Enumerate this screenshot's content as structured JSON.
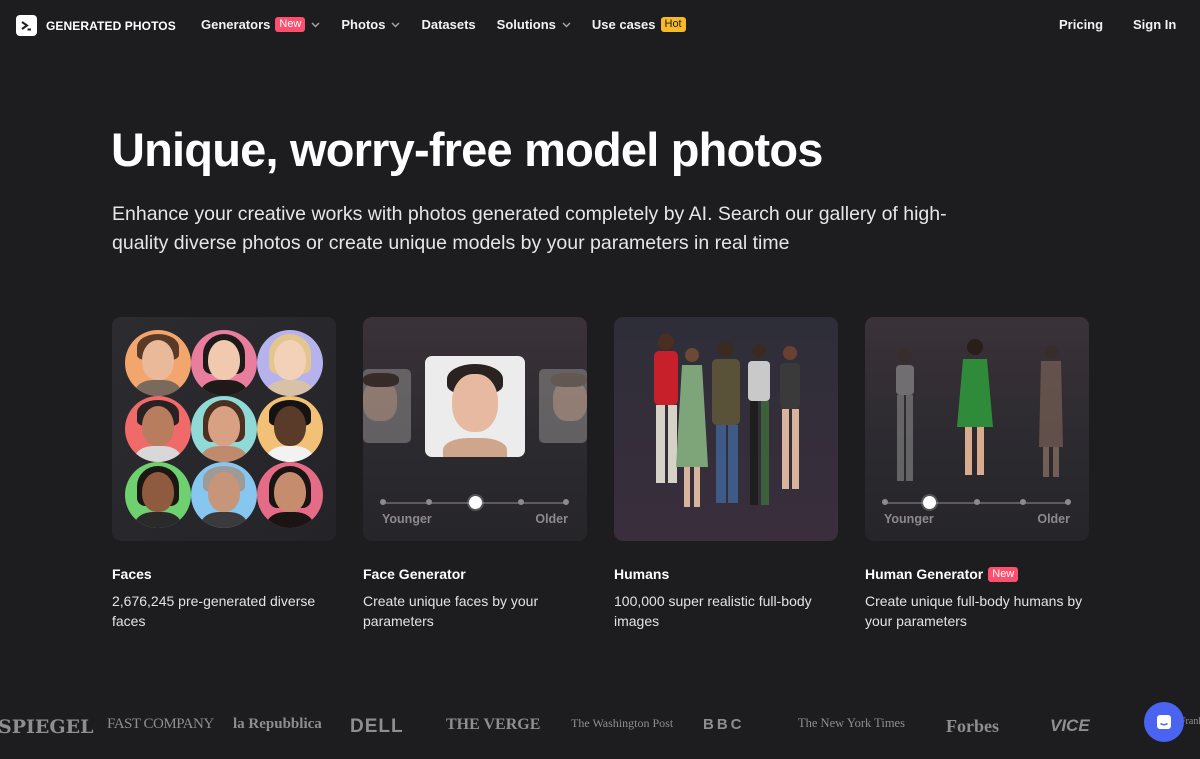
{
  "header": {
    "brand": "GENERATED PHOTOS",
    "nav": [
      {
        "label": "Generators",
        "badge": "New",
        "dropdown": true
      },
      {
        "label": "Photos",
        "badge": "",
        "dropdown": true
      },
      {
        "label": "Datasets",
        "badge": "",
        "dropdown": false
      },
      {
        "label": "Solutions",
        "badge": "",
        "dropdown": true
      },
      {
        "label": "Use cases",
        "badge": "Hot",
        "dropdown": false
      }
    ],
    "pricing": "Pricing",
    "sign_in": "Sign In"
  },
  "hero": {
    "title": "Unique, worry-free model photos",
    "subtitle": "Enhance your creative works with photos generated completely by AI. Search our gallery of high-quality diverse photos or create unique models by your parameters in real time"
  },
  "cards": [
    {
      "title": "Faces",
      "badge": "",
      "desc": "2,676,245 pre-generated diverse faces"
    },
    {
      "title": "Face Generator",
      "badge": "",
      "desc": "Create unique faces by your parameters",
      "slider_min": "Younger",
      "slider_max": "Older",
      "slider_position": 0.5
    },
    {
      "title": "Humans",
      "badge": "",
      "desc": "100,000 super realistic full-body images"
    },
    {
      "title": "Human Generator",
      "badge": "New",
      "desc": "Create unique full-body humans by your parameters",
      "slider_min": "Younger",
      "slider_max": "Older",
      "slider_position": 0.25
    }
  ],
  "press_logos": [
    "SPIEGEL",
    "FAST COMPANY",
    "la Repubblica",
    "DELL",
    "THE VERGE",
    "The Washington Post",
    "BBC",
    "The New York Times",
    "Forbes",
    "VICE",
    "Frankfurter"
  ],
  "colors": {
    "background": "#1d1d1f",
    "badge_new": "#ff4f6e",
    "badge_hot": "#f7b928",
    "chat_button": "#4a63f0"
  },
  "icons": [
    "logo-arrow-icon",
    "chevron-down-icon",
    "chat-icon"
  ]
}
